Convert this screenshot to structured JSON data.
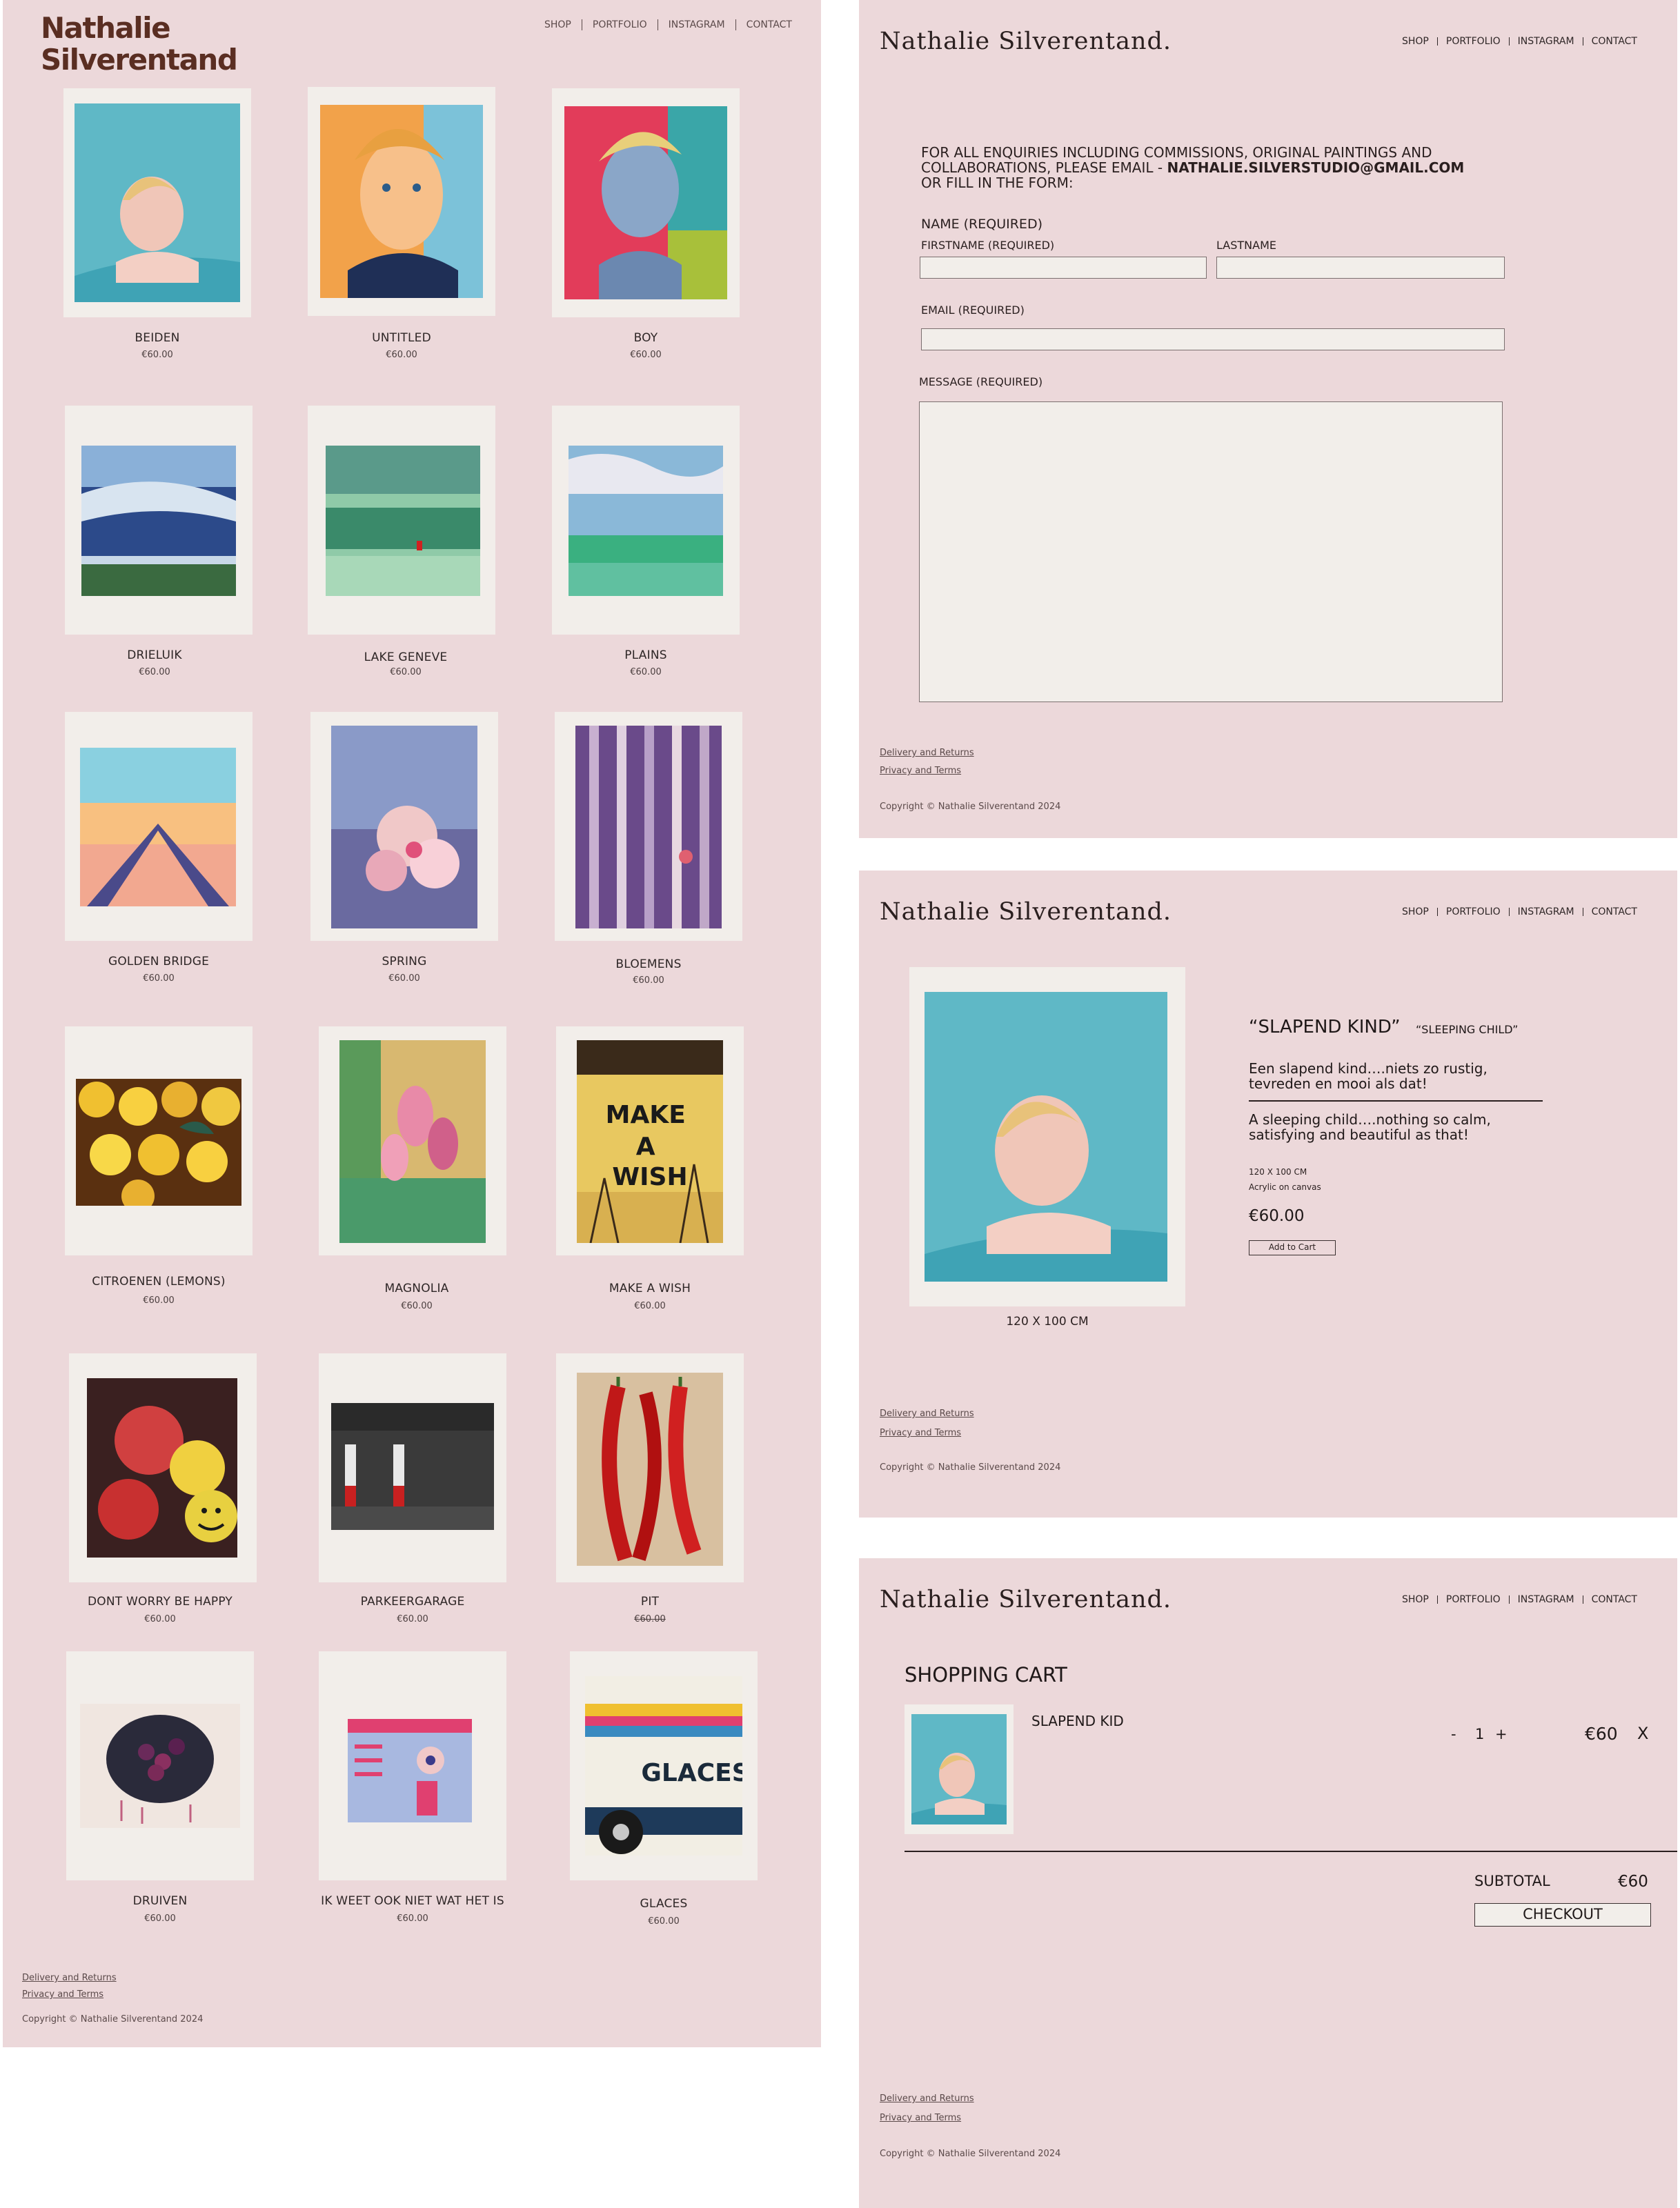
{
  "shop": {
    "brand": {
      "line1": "Nathalie",
      "line2": "Silverentand"
    },
    "nav": [
      "SHOP",
      "PORTFOLIO",
      "INSTAGRAM",
      "CONTACT"
    ],
    "artworks": [
      {
        "title": "BEIDEN",
        "price": "€60.00"
      },
      {
        "title": "UNTITLED",
        "price": "€60.00"
      },
      {
        "title": "BOY",
        "price": "€60.00"
      },
      {
        "title": "DRIELUIK",
        "price": "€60.00"
      },
      {
        "title": "LAKE GENEVE",
        "price": "€60.00"
      },
      {
        "title": "PLAINS",
        "price": "€60.00"
      },
      {
        "title": "GOLDEN BRIDGE",
        "price": "€60.00"
      },
      {
        "title": "SPRING",
        "price": "€60.00"
      },
      {
        "title": "BLOEMENS",
        "price": "€60.00"
      },
      {
        "title": "CITROENEN (LEMONS)",
        "price": "€60.00"
      },
      {
        "title": "MAGNOLIA",
        "price": "€60.00"
      },
      {
        "title": "MAKE A WISH",
        "price": "€60.00"
      },
      {
        "title": "DONT WORRY BE HAPPY",
        "price": "€60.00"
      },
      {
        "title": "PARKEERGARAGE",
        "price": "€60.00"
      },
      {
        "title": "PIT",
        "price": "€60.00",
        "price_overlay": "€60.00"
      },
      {
        "title": "DRUIVEN",
        "price": "€60.00"
      },
      {
        "title": "IK WEET OOK NIET WAT HET IS",
        "price": "€60.00"
      },
      {
        "title": "GLACES",
        "price": "€60.00"
      }
    ],
    "art_text": {
      "make_a_wish": "MAKE A WISH",
      "glaces": "GLACES"
    },
    "footer": {
      "delivery": "Delivery and Returns",
      "privacy": "Privacy and Terms",
      "copyright": "Copyright © Nathalie Silverentand 2024"
    }
  },
  "site": {
    "title": "Nathalie Silverentand.",
    "nav": [
      "SHOP",
      "PORTFOLIO",
      "INSTAGRAM",
      "CONTACT"
    ],
    "footer": {
      "delivery": "Delivery and Returns",
      "privacy": "Privacy and Terms",
      "copyright": "Copyright © Nathalie Silverentand 2024"
    }
  },
  "contact": {
    "intro_line1": "FOR ALL ENQUIRIES INCLUDING COMMISSIONS, ORIGINAL PAINTINGS AND",
    "intro_line2_pre": "COLLABORATIONS, PLEASE EMAIL - ",
    "email": "NATHALIE.SILVERSTUDIO@GMAIL.COM",
    "intro_line3": "OR FILL IN THE FORM:",
    "name_label": "NAME (REQUIRED)",
    "firstname_label": "FIRSTNAME (REQUIRED)",
    "lastname_label": "LASTNAME",
    "email_label": "EMAIL (REQUIRED)",
    "message_label": "MESSAGE (REQUIRED)"
  },
  "product": {
    "caption": "120 X 100 CM",
    "title": "“SLAPEND KIND”",
    "subtitle": "“SLEEPING CHILD”",
    "desc_nl_1": "Een slapend kind….niets zo rustig,",
    "desc_nl_2": "tevreden en mooi als dat!",
    "desc_en_1": "A sleeping child….nothing so calm,",
    "desc_en_2": "satisfying and beautiful as that!",
    "size": "120 X 100 CM",
    "medium": "Acrylic on canvas",
    "price": "€60.00",
    "add_to_cart": "Add to Cart"
  },
  "cart": {
    "heading": "SHOPPING CART",
    "item_name": "SLAPEND KID",
    "qty_minus": "-",
    "qty": "1",
    "qty_plus": "+",
    "item_price": "€60",
    "remove": "X",
    "subtotal_label": "SUBTOTAL",
    "subtotal_value": "€60",
    "checkout": "CHECKOUT"
  },
  "colors": {
    "panel_bg": "#ecd8da",
    "frame_bg": "#f2eeea",
    "brand": "#5a2e22"
  }
}
